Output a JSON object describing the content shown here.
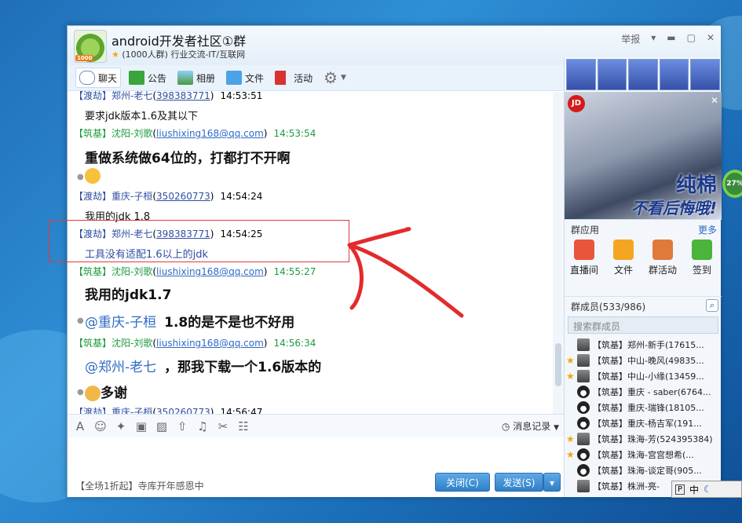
{
  "window": {
    "title": "android开发者社区①群",
    "subtitle": "(1000人群) 行业交流-IT/互联网",
    "avatar_badge": "1000",
    "report_label": "举报"
  },
  "toolbar": [
    {
      "label": "聊天",
      "icon": "chat-icon"
    },
    {
      "label": "公告",
      "icon": "announcement-icon"
    },
    {
      "label": "相册",
      "icon": "album-icon"
    },
    {
      "label": "文件",
      "icon": "folder-icon"
    },
    {
      "label": "活动",
      "icon": "flag-icon"
    }
  ],
  "messages": [
    {
      "tag": "【渡劫】",
      "name": "郑州-老七",
      "qq": "398383771",
      "time": "14:53:51",
      "color": "blue"
    },
    {
      "text": "要求jdk版本1.6及其以下"
    },
    {
      "tag": "【筑基】",
      "name": "沈阳-刘歌",
      "qq": "liushixing168@qq.com",
      "time": "14:53:54",
      "color": "green"
    },
    {
      "text": "重做系统做64位的，打都打不开啊"
    },
    {
      "tag": "【渡劫】",
      "name": "重庆-子桓",
      "qq": "350260773",
      "time": "14:54:24",
      "color": "blue"
    },
    {
      "text": "我用的jdk 1.8"
    },
    {
      "tag": "【渡劫】",
      "name": "郑州-老七",
      "qq": "398383771",
      "time": "14:54:25",
      "color": "blue"
    },
    {
      "text": "工具没有适配1.6以上的jdk"
    },
    {
      "tag": "【筑基】",
      "name": "沈阳-刘歌",
      "qq": "liushixing168@qq.com",
      "time": "14:55:27",
      "color": "green"
    },
    {
      "text": "我用的jdk1.7"
    },
    {
      "at": "@重庆-子桓",
      "text": "1.8的是不是也不好用"
    },
    {
      "tag": "【筑基】",
      "name": "沈阳-刘歌",
      "qq": "liushixing168@qq.com",
      "time": "14:56:34",
      "color": "green"
    },
    {
      "at": "@郑州-老七",
      "text": "，那我下载一个1.6版本的"
    },
    {
      "text": "多谢"
    },
    {
      "tag": "【渡劫】",
      "name": "重庆-子桓",
      "qq": "350260773",
      "time": "14:56:47",
      "color": "blue"
    }
  ],
  "input": {
    "history_label": "消息记录",
    "status_text": "【全场1折起】寺库开年感恩中",
    "close_label": "关闭(C)",
    "send_label": "发送(S)"
  },
  "ad": {
    "badge": "JD",
    "line1": "纯棉",
    "line2": "不看后悔哦!"
  },
  "apps": {
    "header": "群应用",
    "more": "更多",
    "items": [
      "直播间",
      "文件",
      "群活动",
      "签到"
    ]
  },
  "members": {
    "header": "群成员(533/986)",
    "search_placeholder": "搜索群成员",
    "list": [
      {
        "text": "【筑基】郑州-新手(17615...",
        "star": false,
        "av": "photo"
      },
      {
        "text": "【筑基】中山-晚风(49835...",
        "star": true,
        "av": "photo"
      },
      {
        "text": "【筑基】中山-小缘(13459...",
        "star": true,
        "av": "photo"
      },
      {
        "text": "【筑基】重庆 - saber(6764...",
        "star": false,
        "av": "penguin"
      },
      {
        "text": "【筑基】重庆-瑞锋(18105...",
        "star": false,
        "av": "penguin"
      },
      {
        "text": "【筑基】重庆-杨吉军(191...",
        "star": false,
        "av": "penguin"
      },
      {
        "text": "【筑基】珠海-芳(524395384)",
        "star": true,
        "av": "photo"
      },
      {
        "text": "【筑基】珠海-宫宫想希(...",
        "star": true,
        "av": "penguin"
      },
      {
        "text": "【筑基】珠海-谈定哥(905...",
        "star": false,
        "av": "penguin"
      },
      {
        "text": "【筑基】株洲-亮-",
        "star": false,
        "av": "photo"
      }
    ]
  },
  "desktop": {
    "gauge": "27%",
    "ime": "中"
  }
}
